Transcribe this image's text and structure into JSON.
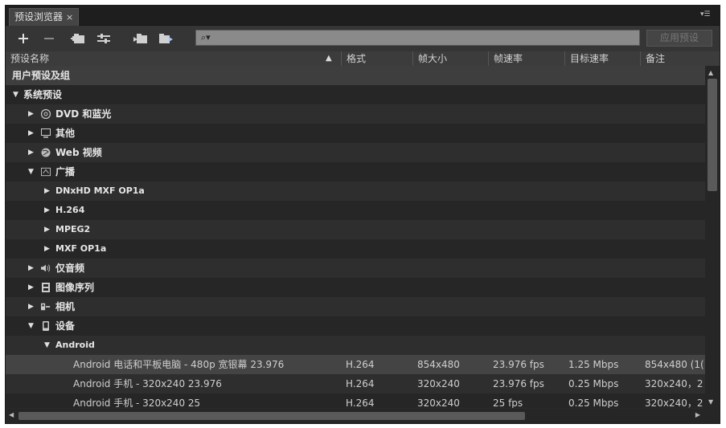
{
  "tab": {
    "title": "预设浏览器",
    "close": "×"
  },
  "toolbar": {
    "search_placeholder": "",
    "search_glyph": "⌕▾",
    "apply_label": "应用预设"
  },
  "columns": [
    "预设名称",
    "格式",
    "帧大小",
    "帧速率",
    "目标速率",
    "备注"
  ],
  "tree": {
    "user_group": "用户预设及组",
    "system_group": "系统预设",
    "items": {
      "dvd": "DVD 和蓝光",
      "other": "其他",
      "web": "Web 视频",
      "broadcast": "广播",
      "dnxhd": "DNxHD MXF OP1a",
      "h264": "H.264",
      "mpeg2": "MPEG2",
      "mxf": "MXF OP1a",
      "audio": "仅音频",
      "image_seq": "图像序列",
      "camera": "相机",
      "devices": "设备",
      "android": "Android"
    },
    "presets": [
      {
        "name": "Android 电话和平板电脑 - 480p 宽银幕 23.976",
        "format": "H.264",
        "frame_size": "854x480",
        "frame_rate": "23.976 fps",
        "target_rate": "1.25 Mbps",
        "note": "854x480 (1("
      },
      {
        "name": "Android 手机 - 320x240 23.976",
        "format": "H.264",
        "frame_size": "320x240",
        "frame_rate": "23.976 fps",
        "target_rate": "0.25 Mbps",
        "note": "320x240，2"
      },
      {
        "name": "Android 手机 - 320x240 25",
        "format": "H.264",
        "frame_size": "320x240",
        "frame_rate": "25 fps",
        "target_rate": "0.25 Mbps",
        "note": "320x240，2"
      }
    ]
  }
}
